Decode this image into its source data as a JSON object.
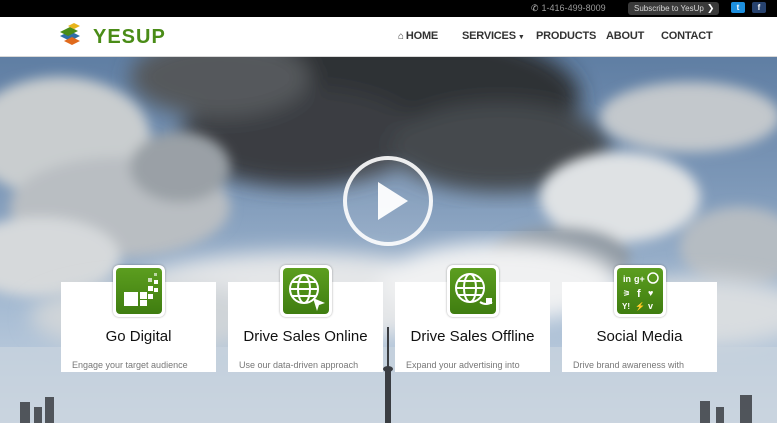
{
  "topbar": {
    "phone": "1-416-499-8009",
    "phone_icon": "phone-icon",
    "subscribe_label": "Subscribe to YesUp",
    "twitter_icon": "twitter-icon",
    "facebook_icon": "facebook-icon"
  },
  "logo": {
    "text": "YESUP"
  },
  "nav": {
    "home": "HOME",
    "services": "SERVICES",
    "products": "PRODUCTS",
    "about": "ABOUT",
    "contact": "CONTACT"
  },
  "hero": {
    "play_icon": "play-icon"
  },
  "cards": [
    {
      "title": "Go Digital",
      "desc": "Engage your target audience",
      "icon": "digital-blocks-icon"
    },
    {
      "title": "Drive Sales Online",
      "desc": "Use our data-driven approach",
      "icon": "globe-cursor-icon"
    },
    {
      "title": "Drive Sales Offline",
      "desc": "Expand your advertising into",
      "icon": "globe-plug-icon"
    },
    {
      "title": "Social Media",
      "desc": "Drive brand awareness with",
      "icon": "social-networks-icon"
    }
  ],
  "colors": {
    "brand_green": "#4a8c17",
    "topbar": "#000000",
    "twitter": "#1d8fde",
    "facebook": "#27426e"
  }
}
